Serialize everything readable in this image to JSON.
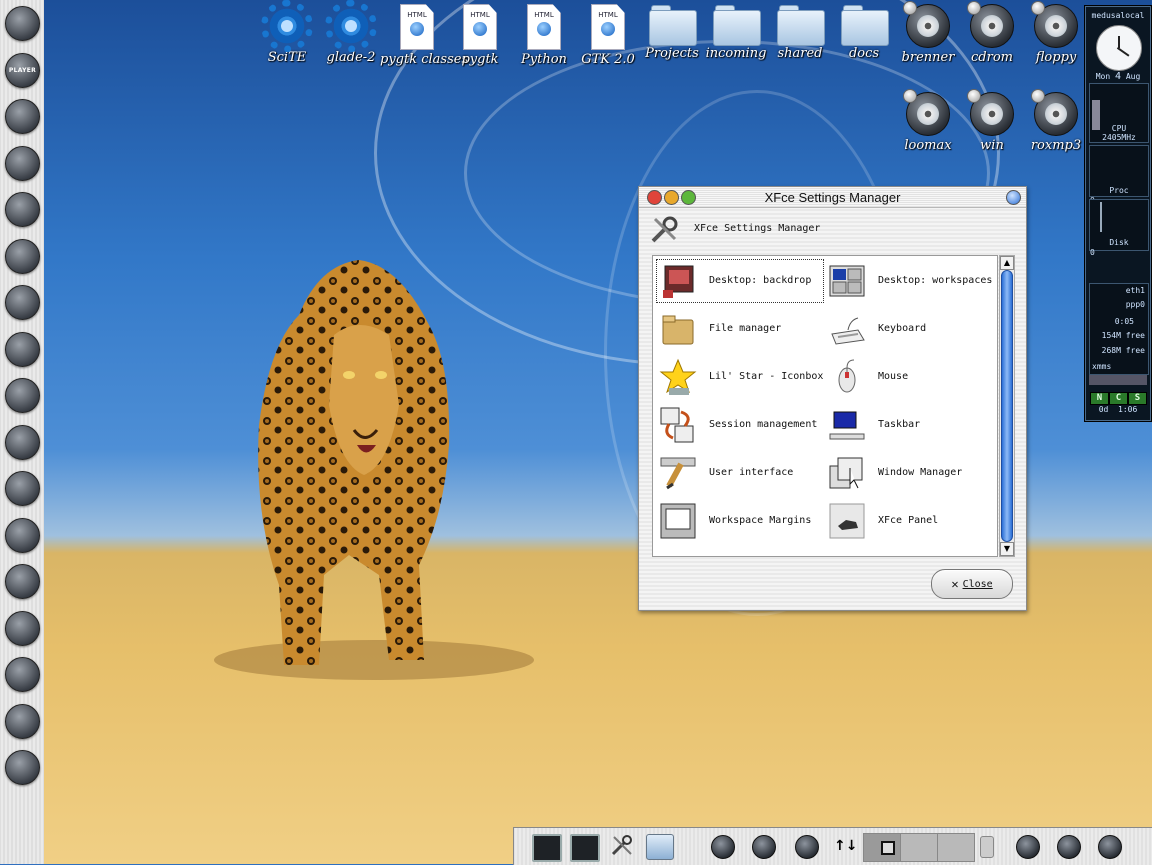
{
  "left_dock": {
    "items": [
      {
        "name": "skull-icon",
        "label": ""
      },
      {
        "name": "player-icon",
        "label": "PLAYER"
      },
      {
        "name": "eyes-icon",
        "label": ""
      },
      {
        "name": "bomb-icon",
        "label": ""
      },
      {
        "name": "network-icon",
        "label": ""
      },
      {
        "name": "check-icon",
        "label": ""
      },
      {
        "name": "window-icon",
        "label": ""
      },
      {
        "name": "pen-icon",
        "label": ""
      },
      {
        "name": "person-icon",
        "label": ""
      },
      {
        "name": "disc-green-icon",
        "label": ""
      },
      {
        "name": "swirl-icon",
        "label": ""
      },
      {
        "name": "wand-icon",
        "label": ""
      },
      {
        "name": "cd-icon",
        "label": ""
      },
      {
        "name": "cd2-icon",
        "label": ""
      },
      {
        "name": "book-icon",
        "label": ""
      },
      {
        "name": "gear-red-icon",
        "label": ""
      },
      {
        "name": "exit-icon",
        "label": ""
      }
    ]
  },
  "desktop_icons": [
    {
      "name": "SciTE",
      "kind": "gear"
    },
    {
      "name": "glade-2",
      "kind": "gear"
    },
    {
      "name": "pygtk classes",
      "kind": "html"
    },
    {
      "name": "pygtk",
      "kind": "html"
    },
    {
      "name": "Python",
      "kind": "html"
    },
    {
      "name": "GTK 2.0",
      "kind": "html"
    },
    {
      "name": "Projects",
      "kind": "folder"
    },
    {
      "name": "incoming",
      "kind": "folder"
    },
    {
      "name": "shared",
      "kind": "folder"
    },
    {
      "name": "docs",
      "kind": "folder"
    },
    {
      "name": "brenner",
      "kind": "disk"
    },
    {
      "name": "cdrom",
      "kind": "disk"
    },
    {
      "name": "floppy",
      "kind": "disk"
    },
    {
      "name": "loomax",
      "kind": "disk"
    },
    {
      "name": "win",
      "kind": "disk"
    },
    {
      "name": "roxmp3",
      "kind": "disk"
    }
  ],
  "html_badge": "HTML",
  "monitor": {
    "host": "medusalocal",
    "date_day": "Mon",
    "date_num": "4",
    "date_month": "Aug",
    "cpu_label": "CPU",
    "cpu_freq": "2405MHz",
    "proc_label": "Proc",
    "proc_value": "0",
    "disk_label": "Disk",
    "disk_value": "0",
    "net1": "eth1",
    "net2": "ppp0",
    "net_time": "0:05",
    "mem1": "154M free",
    "mem2": "268M free",
    "xmms": "xmms",
    "ncs": [
      "N",
      "C",
      "S"
    ],
    "uptime_days": "0d",
    "uptime_time": "1:06"
  },
  "settings_window": {
    "title": "XFce Settings Manager",
    "header_label": "XFce Settings Manager",
    "items": [
      {
        "label": "Desktop: backdrop",
        "icon": "backdrop-icon"
      },
      {
        "label": "Desktop: workspaces",
        "icon": "workspaces-icon"
      },
      {
        "label": "File manager",
        "icon": "folder-icon"
      },
      {
        "label": "Keyboard",
        "icon": "keyboard-icon"
      },
      {
        "label": "Lil' Star - Iconbox",
        "icon": "star-icon"
      },
      {
        "label": "Mouse",
        "icon": "mouse-icon"
      },
      {
        "label": "Session management",
        "icon": "session-icon"
      },
      {
        "label": "Taskbar",
        "icon": "taskbar-icon"
      },
      {
        "label": "User interface",
        "icon": "ui-icon"
      },
      {
        "label": "Window Manager",
        "icon": "window-manager-icon"
      },
      {
        "label": "Workspace Margins",
        "icon": "margins-icon"
      },
      {
        "label": "XFce Panel",
        "icon": "panel-icon"
      }
    ],
    "selected_index": 0,
    "close_label": "Close"
  },
  "colors": {
    "accent": "#2b6fd6",
    "tl_close": "#e0443a",
    "tl_min": "#e8a82c",
    "tl_max": "#5db73c"
  }
}
